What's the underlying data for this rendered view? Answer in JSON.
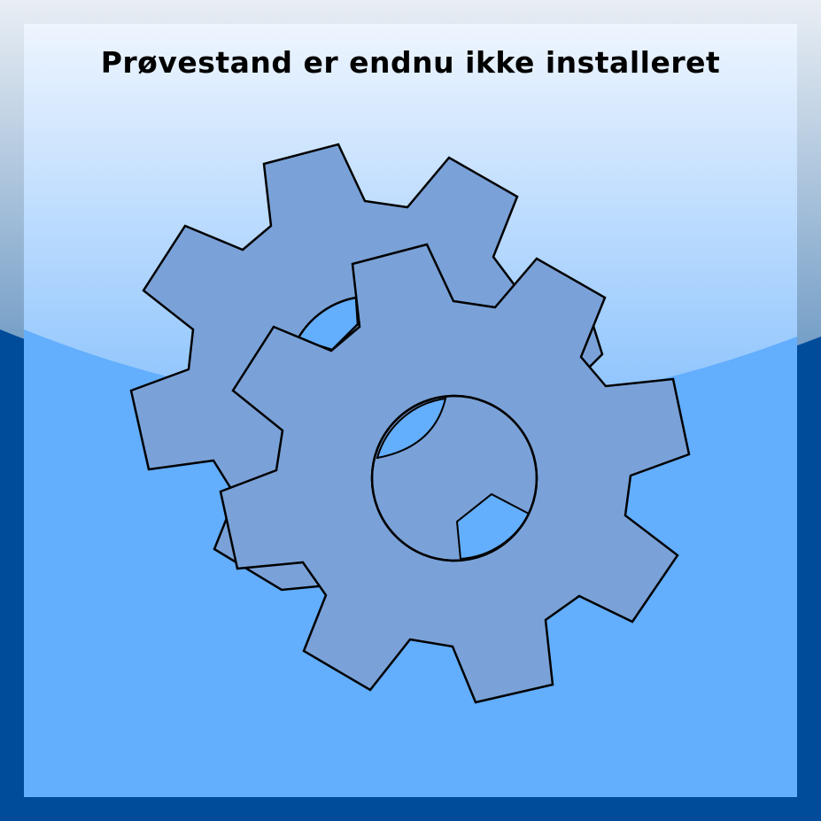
{
  "title": "Prøvestand er endnu ikke installeret",
  "icon": "gears-icon",
  "colors": {
    "frame": "#004c9a",
    "panel": "#63aefd",
    "gear_fill": "#7aa2d8",
    "gear_stroke": "#000000",
    "gear_hole": "#63aefd",
    "gloss_top": "#ffffff"
  }
}
